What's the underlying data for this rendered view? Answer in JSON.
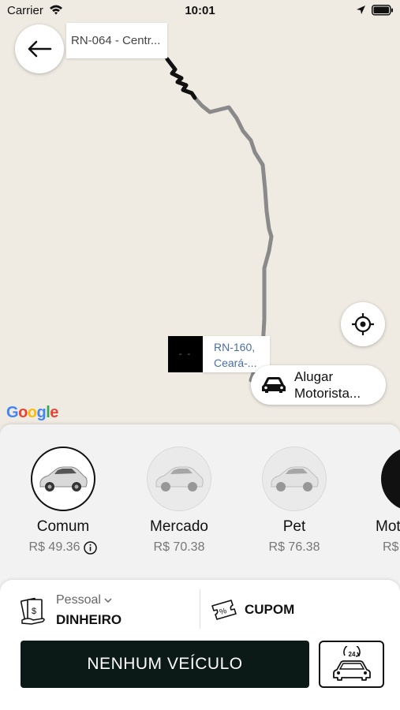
{
  "status_bar": {
    "carrier": "Carrier",
    "time": "10:01"
  },
  "map": {
    "origin_label": "RN-064 - Centr...",
    "destination_marker": "- -",
    "destination_label_line1": "RN-160,",
    "destination_label_line2": "Ceará-...",
    "rent_driver_line1": "Alugar",
    "rent_driver_line2": "Motorista...",
    "google_logo": "Google",
    "route_color": "#8a8a8a",
    "route_start_color": "#111111"
  },
  "categories": [
    {
      "name": "Comum",
      "price": "R$ 49.36",
      "selected": true,
      "icon": "car-icon"
    },
    {
      "name": "Mercado",
      "price": "R$ 70.38",
      "selected": false,
      "icon": "car-icon"
    },
    {
      "name": "Pet",
      "price": "R$ 76.38",
      "selected": false,
      "icon": "car-icon"
    },
    {
      "name": "Mot",
      "price": "R$",
      "selected": false,
      "icon": "motorcycle-icon"
    }
  ],
  "payment": {
    "label": "Pessoal",
    "value": "DINHEIRO"
  },
  "coupon": {
    "label": "CUPOM"
  },
  "main_button": {
    "label": "NENHUM VEÍCULO"
  },
  "h24_icon_text": "24",
  "colors": {
    "primary_dark": "#0c1a17",
    "map_bg": "#efebe3"
  }
}
